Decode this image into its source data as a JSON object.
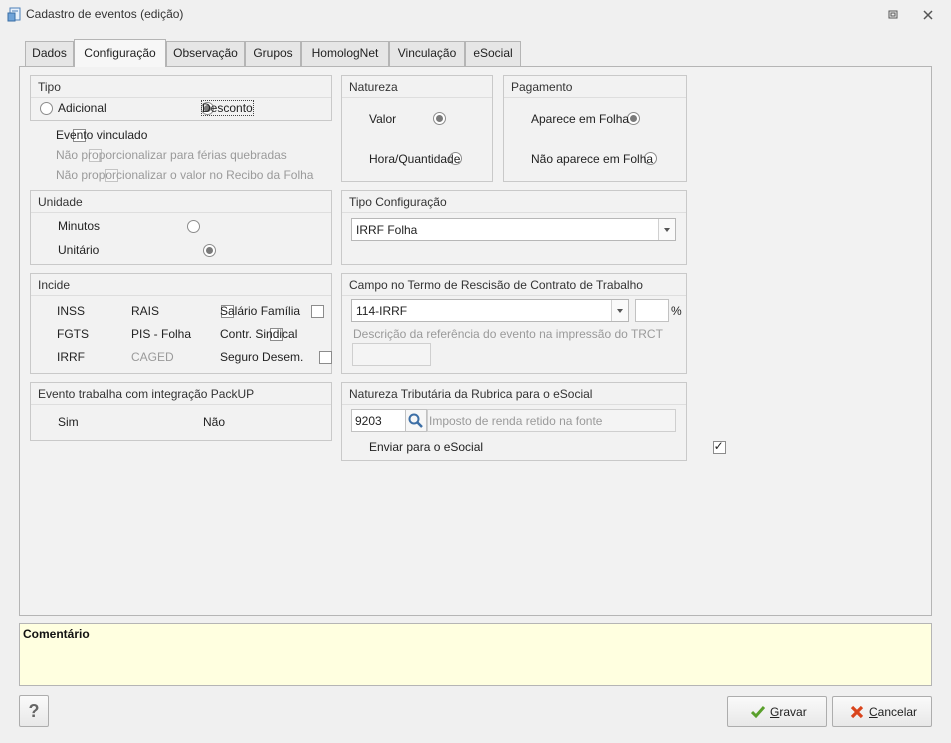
{
  "window": {
    "title": "Cadastro de eventos (edição)",
    "restore_icon": "restore-icon",
    "close_icon": "close-icon"
  },
  "tabs": [
    {
      "label": "Dados",
      "active": false
    },
    {
      "label": "Configuração",
      "active": true
    },
    {
      "label": "Observação",
      "active": false
    },
    {
      "label": "Grupos",
      "active": false
    },
    {
      "label": "HomologNet",
      "active": false
    },
    {
      "label": "Vinculação",
      "active": false
    },
    {
      "label": "eSocial",
      "active": false
    }
  ],
  "tipo": {
    "title": "Tipo",
    "options": [
      {
        "label": "Adicional",
        "checked": false
      },
      {
        "label": "Desconto",
        "checked": true
      }
    ]
  },
  "checks_after_tipo": [
    {
      "label": "Evento vinculado",
      "checked": false,
      "enabled": true
    },
    {
      "label": "Não proporcionalizar para férias quebradas",
      "checked": false,
      "enabled": false
    },
    {
      "label": "Não proporcionalizar o valor no Recibo da Folha",
      "checked": false,
      "enabled": false
    }
  ],
  "natureza": {
    "title": "Natureza",
    "options": [
      {
        "label": "Valor",
        "checked": true
      },
      {
        "label": "Hora/Quantidade",
        "checked": false
      }
    ]
  },
  "pagamento": {
    "title": "Pagamento",
    "options": [
      {
        "label": "Aparece em Folha",
        "checked": true
      },
      {
        "label": "Não aparece em Folha",
        "checked": false
      }
    ]
  },
  "unidade": {
    "title": "Unidade",
    "options": [
      {
        "label": "Minutos",
        "checked": false
      },
      {
        "label": "Unitário",
        "checked": true
      }
    ]
  },
  "tipo_configuracao": {
    "title": "Tipo Configuração",
    "value": "IRRF Folha"
  },
  "incide": {
    "title": "Incide",
    "items": [
      {
        "label": "INSS",
        "checked": false,
        "enabled": true
      },
      {
        "label": "RAIS",
        "checked": false,
        "enabled": true
      },
      {
        "label": "Salário Família",
        "checked": false,
        "enabled": true
      },
      {
        "label": "FGTS",
        "checked": false,
        "enabled": true
      },
      {
        "label": "PIS - Folha",
        "checked": false,
        "enabled": true
      },
      {
        "label": "Contr. Sindical",
        "checked": false,
        "enabled": true
      },
      {
        "label": "IRRF",
        "checked": false,
        "enabled": true
      },
      {
        "label": "CAGED",
        "checked": false,
        "enabled": false
      },
      {
        "label": "Seguro Desem.",
        "checked": false,
        "enabled": true
      }
    ]
  },
  "campo_trct": {
    "title": "Campo no Termo de Rescisão de Contrato de Trabalho",
    "value": "114-IRRF",
    "percent_value": "",
    "percent_symbol": "%",
    "descricao_label": "Descrição da referência do evento na impressão do TRCT",
    "descricao_value": ""
  },
  "packup": {
    "title": "Evento trabalha com integração PackUP",
    "options": [
      {
        "label": "Sim",
        "checked": false
      },
      {
        "label": "Não",
        "checked": false
      }
    ]
  },
  "natureza_tributaria": {
    "title": "Natureza Tributária da Rubrica para o eSocial",
    "code": "9203",
    "search_icon": "search-icon",
    "description": "Imposto de renda retido na fonte",
    "enviar_label": "Enviar para o eSocial",
    "enviar_checked": true
  },
  "comentario": {
    "label": "Comentário",
    "value": ""
  },
  "footer": {
    "help_label": "?",
    "gravar_label": "Gravar",
    "cancelar_label": "Cancelar",
    "colors": {
      "gravar_icon": "#5aa02c",
      "cancelar_icon": "#d9441c"
    }
  }
}
